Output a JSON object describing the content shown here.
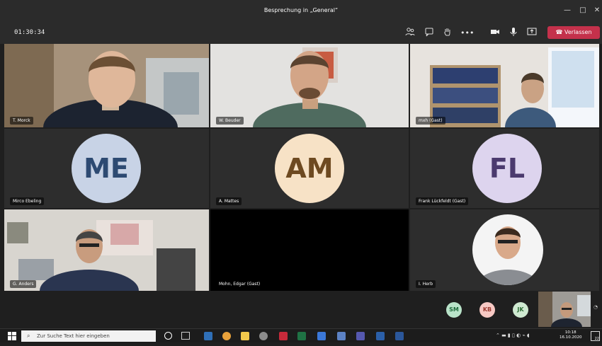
{
  "window": {
    "title": "Besprechung in „General“",
    "min": "—",
    "max": "□",
    "close": "✕"
  },
  "toolbar": {
    "timer": "01:30:34",
    "leave_label": "Verlassen"
  },
  "tiles": [
    {
      "name": "T. Morck"
    },
    {
      "name": "W. Beuder"
    },
    {
      "name": "mxh (Gast)"
    },
    {
      "name": "Mirco Ebeling",
      "initials": "ME",
      "bg": "#c8d3e6",
      "fg": "#2d4a72"
    },
    {
      "name": "A. Mattes",
      "initials": "AM",
      "bg": "#f7e2c6",
      "fg": "#6e4a21"
    },
    {
      "name": "Frank Lückfeldt (Gast)",
      "initials": "FL",
      "bg": "#ddd4ee",
      "fg": "#4b3a6e"
    },
    {
      "name": "G. Anders"
    },
    {
      "name": "Mohn, Edgar (Gast)"
    },
    {
      "name": "I. Herb"
    }
  ],
  "overflow": [
    {
      "initials": "SM",
      "bg": "#b9e3c9",
      "fg": "#1e6b3c"
    },
    {
      "initials": "KB",
      "bg": "#f7c9c4",
      "fg": "#9b3a30"
    },
    {
      "initials": "JK",
      "bg": "#cfe9d1",
      "fg": "#2c6b34"
    }
  ],
  "taskbar": {
    "search_placeholder": "Zur Suche Text hier eingeben",
    "time": "10:18",
    "date": "16.10.2020",
    "notif": "22"
  }
}
